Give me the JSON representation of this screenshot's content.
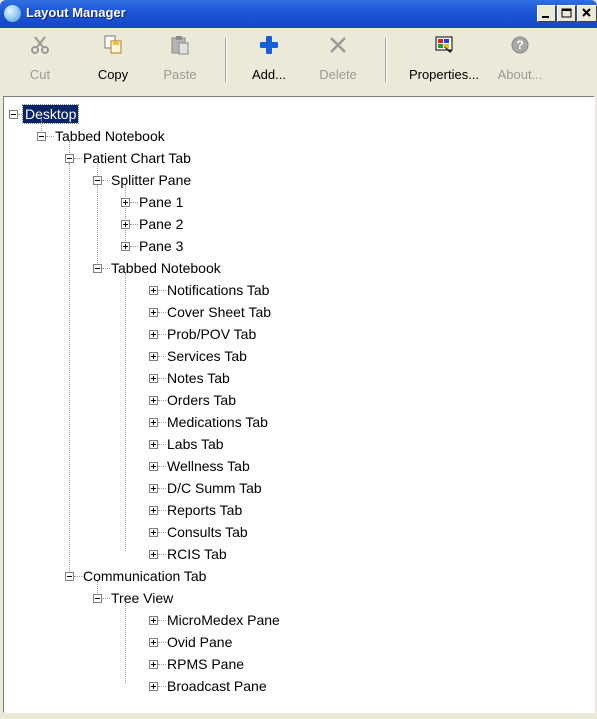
{
  "window": {
    "title": "Layout Manager",
    "controls": [
      "minimize-icon",
      "maximize-icon",
      "close-icon"
    ]
  },
  "toolbar": {
    "cut": {
      "label": "Cut",
      "icon": "scissors-icon",
      "enabled": false
    },
    "copy": {
      "label": "Copy",
      "icon": "copy-icon",
      "enabled": true
    },
    "paste": {
      "label": "Paste",
      "icon": "paste-icon",
      "enabled": false
    },
    "add": {
      "label": "Add...",
      "icon": "plus-icon",
      "enabled": true
    },
    "delete": {
      "label": "Delete",
      "icon": "delete-x-icon",
      "enabled": false
    },
    "properties": {
      "label": "Properties...",
      "icon": "properties-icon",
      "enabled": true
    },
    "about": {
      "label": "About...",
      "icon": "help-icon",
      "enabled": false
    }
  },
  "tree": {
    "desktop": "Desktop",
    "tabbed_notebook": "Tabbed Notebook",
    "patient_chart_tab": "Patient Chart Tab",
    "splitter_pane": "Splitter Pane",
    "pane_1": "Pane 1",
    "pane_2": "Pane 2",
    "pane_3": "Pane 3",
    "inner_tabbed_notebook": "Tabbed Notebook",
    "tabs": [
      "Notifications Tab",
      "Cover Sheet Tab",
      "Prob/POV Tab",
      "Services Tab",
      "Notes Tab",
      "Orders Tab",
      "Medications Tab",
      "Labs Tab",
      "Wellness Tab",
      "D/C Summ Tab",
      "Reports Tab",
      "Consults Tab",
      "RCIS Tab"
    ],
    "communication_tab": "Communication Tab",
    "tree_view": "Tree View",
    "panes": [
      "MicroMedex Pane",
      "Ovid Pane",
      "RPMS Pane",
      "Broadcast Pane"
    ]
  },
  "colors": {
    "title_bar": "#1d56d8",
    "selection": "#0a246a",
    "window_bg": "#ece9d8",
    "add_icon": "#1560d8"
  }
}
